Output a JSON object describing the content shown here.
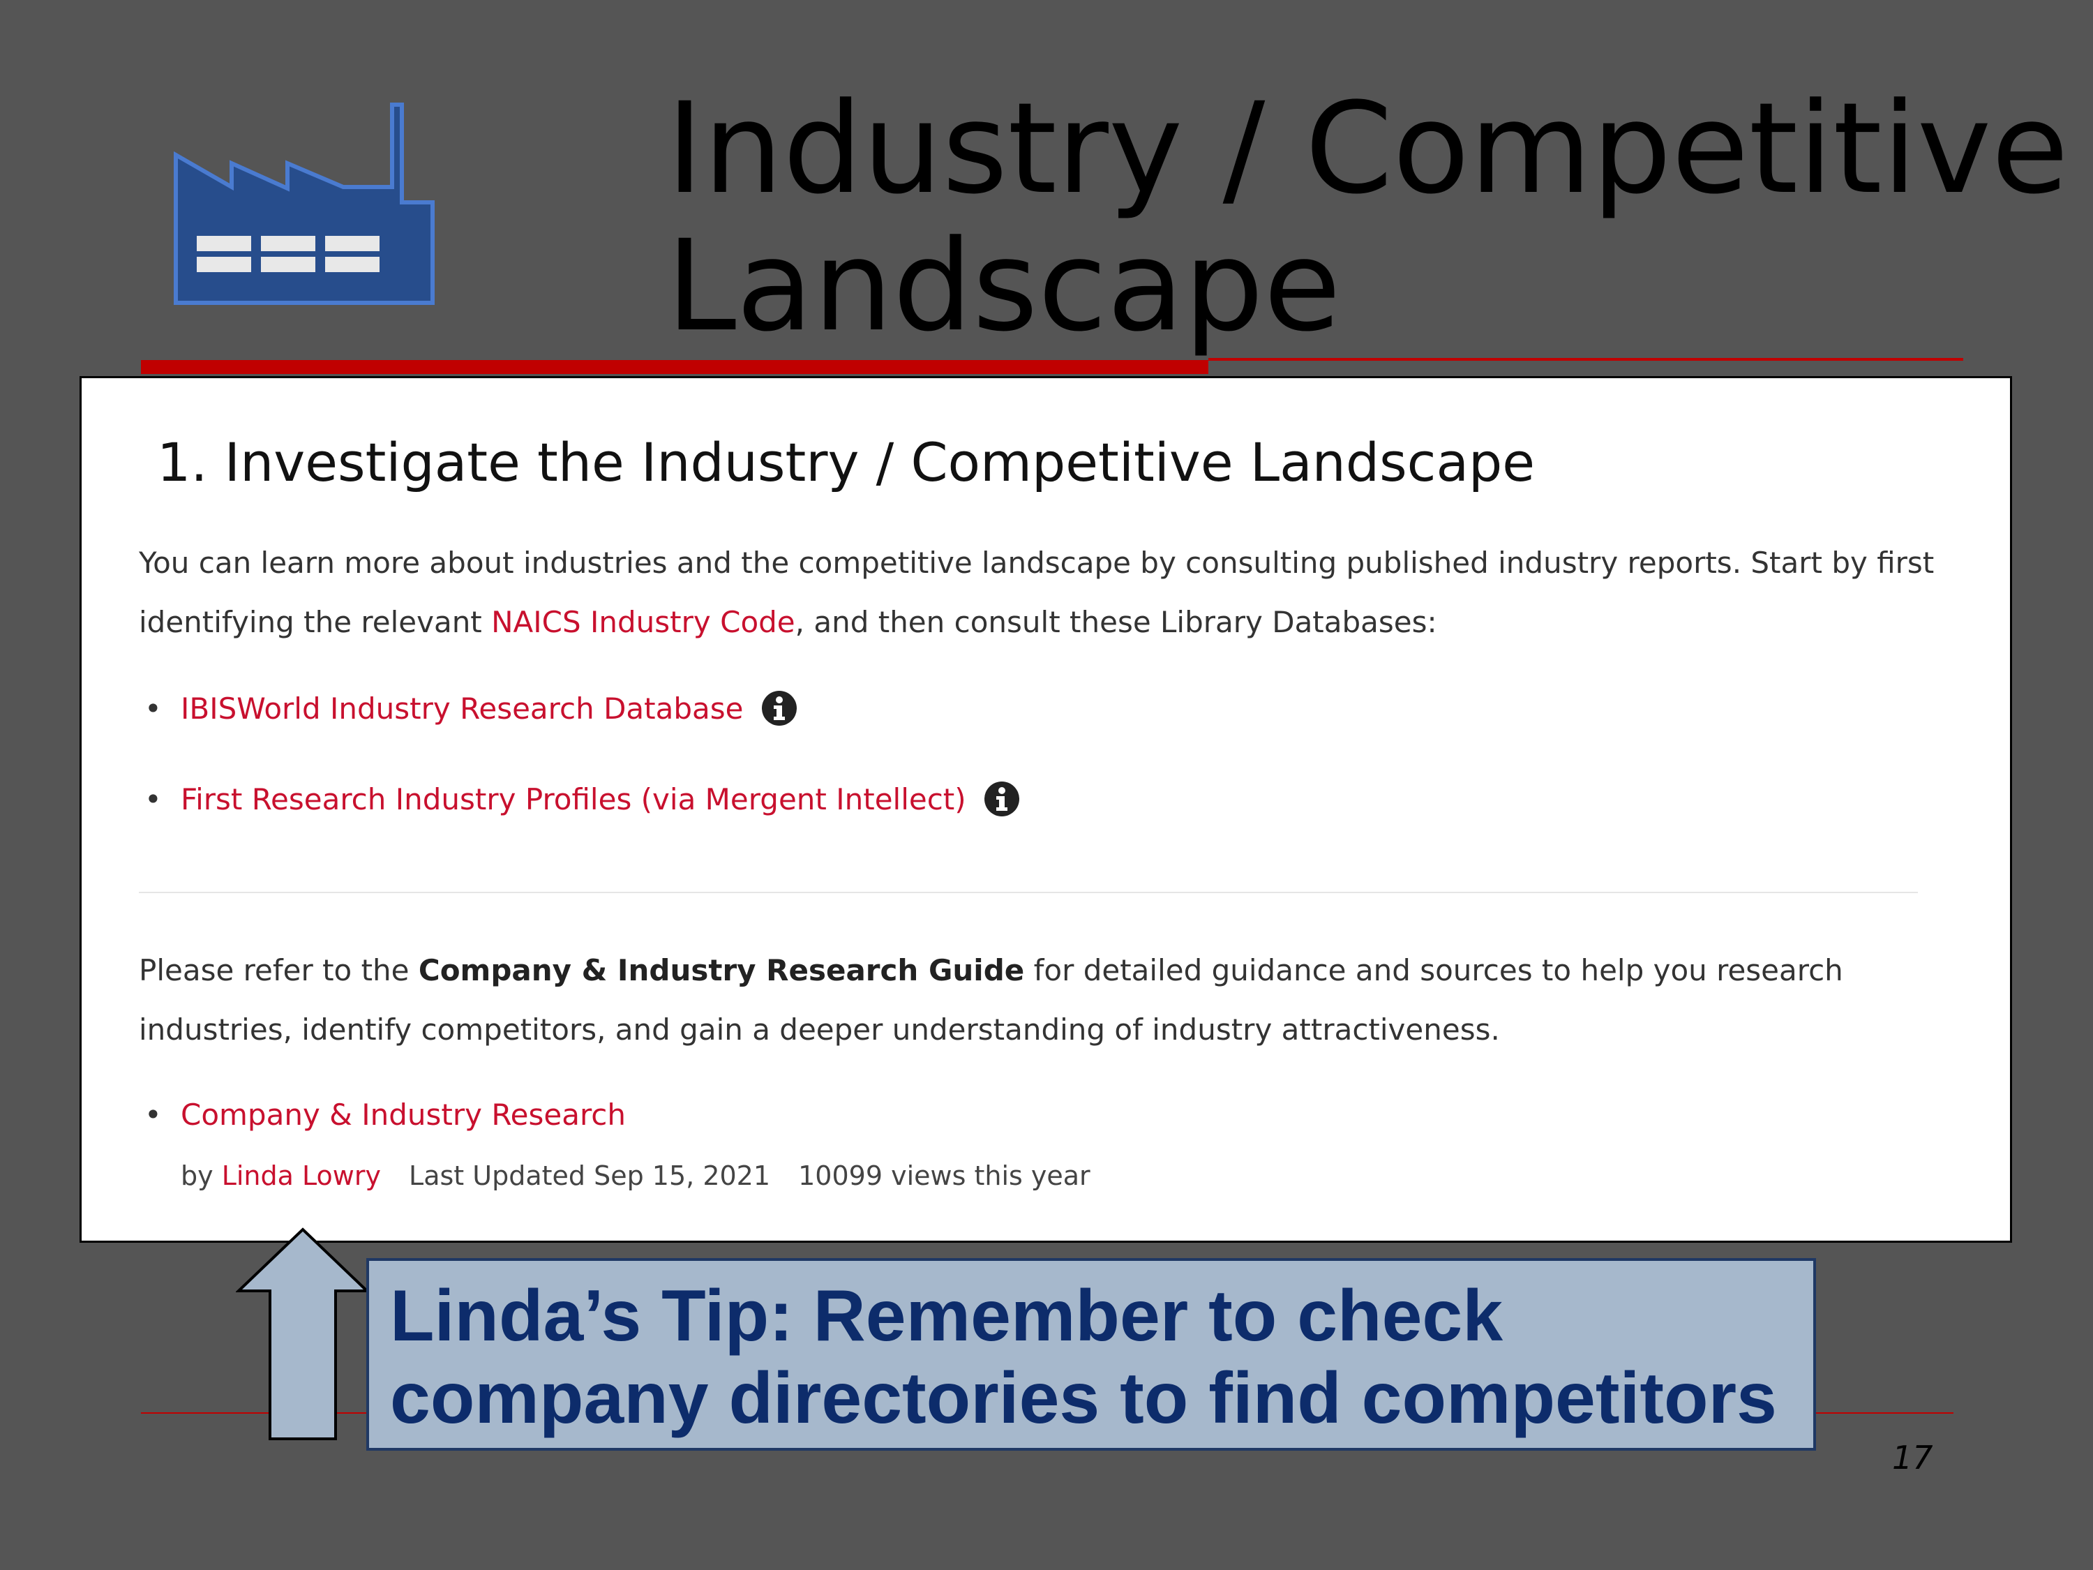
{
  "slide": {
    "title_line1": "Industry / Competitive",
    "title_line2": "Landscape",
    "page_number": "17",
    "icon": "factory-icon",
    "accent_color": "#c00000"
  },
  "panel": {
    "heading": "1. Investigate the Industry / Competitive Landscape",
    "intro_part1": "You can learn more about industries and the competitive landscape by consulting published industry reports. Start by first identifying the relevant ",
    "intro_link": "NAICS Industry Code",
    "intro_part2": ", and then consult these Library Databases:",
    "databases": [
      {
        "label": "IBISWorld Industry Research Database",
        "icon": "info-icon"
      },
      {
        "label": "First Research Industry Profiles (via Mergent Intellect)",
        "icon": "info-icon"
      }
    ],
    "guide_part1": "Please refer to the ",
    "guide_bold": "Company & Industry Research Guide",
    "guide_part2": " for detailed guidance and sources to help you research industries, identify competitors, and gain a deeper understanding of industry attractiveness.",
    "guide_link": "Company & Industry Research",
    "guide_by": "by ",
    "guide_author": "Linda Lowry",
    "guide_updated": "Last Updated Sep 15, 2021",
    "guide_views": "10099 views this year",
    "link_color": "#c8102e"
  },
  "tip": {
    "line1": "Linda’s Tip: Remember to check",
    "line2": "company directories to find competitors",
    "arrow_icon": "up-arrow-icon"
  }
}
